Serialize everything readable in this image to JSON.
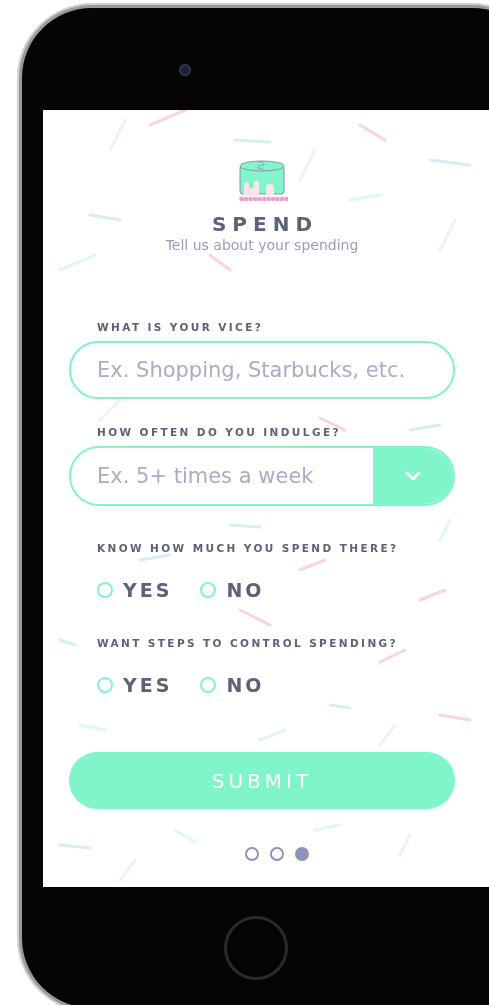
{
  "header": {
    "title": "SPEND",
    "subtitle": "Tell us about your spending"
  },
  "vice": {
    "label": "WHAT IS YOUR VICE?",
    "placeholder": "Ex. Shopping, Starbucks, etc."
  },
  "frequency": {
    "label": "HOW OFTEN DO YOU INDULGE?",
    "placeholder": "Ex. 5+ times a week"
  },
  "questions": [
    {
      "label": "KNOW HOW MUCH YOU SPEND THERE?",
      "options": [
        {
          "label": "YES",
          "selected": false
        },
        {
          "label": "NO",
          "selected": false
        }
      ]
    },
    {
      "label": "WANT STEPS TO CONTROL SPENDING?",
      "options": [
        {
          "label": "YES",
          "selected": false
        },
        {
          "label": "NO",
          "selected": false
        }
      ]
    }
  ],
  "submit": "SUBMIT",
  "pages": [
    {
      "selected": false
    },
    {
      "selected": false
    },
    {
      "selected": true
    }
  ]
}
